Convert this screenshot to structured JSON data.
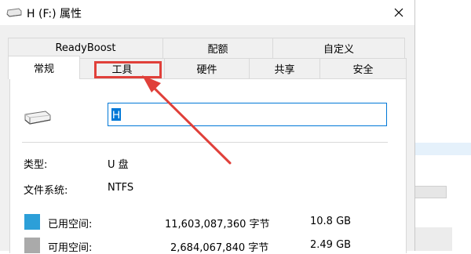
{
  "window": {
    "title": "H (F:) 属性"
  },
  "tabs": {
    "top": [
      {
        "label": "ReadyBoost"
      },
      {
        "label": "配额"
      },
      {
        "label": "自定义"
      }
    ],
    "bottom": [
      {
        "label": "常规"
      },
      {
        "label": "工具"
      },
      {
        "label": "硬件"
      },
      {
        "label": "共享"
      },
      {
        "label": "安全"
      }
    ],
    "active": "常规",
    "highlighted": "工具"
  },
  "general": {
    "drive_name": "H",
    "type_label": "类型:",
    "type_value": "U 盘",
    "fs_label": "文件系统:",
    "fs_value": "NTFS",
    "used": {
      "label": "已用空间:",
      "bytes": "11,603,087,360 字节",
      "size": "10.8 GB",
      "color": "#2c9fd8"
    },
    "free": {
      "label": "可用空间:",
      "bytes": "2,684,067,840 字节",
      "size": "2.49 GB",
      "color": "#aaaaaa"
    }
  },
  "colors": {
    "highlight": "#e0403a",
    "accent": "#0078d7"
  },
  "icons": {
    "title": "drive-icon",
    "close": "close-icon",
    "drive": "usb-drive-icon"
  }
}
